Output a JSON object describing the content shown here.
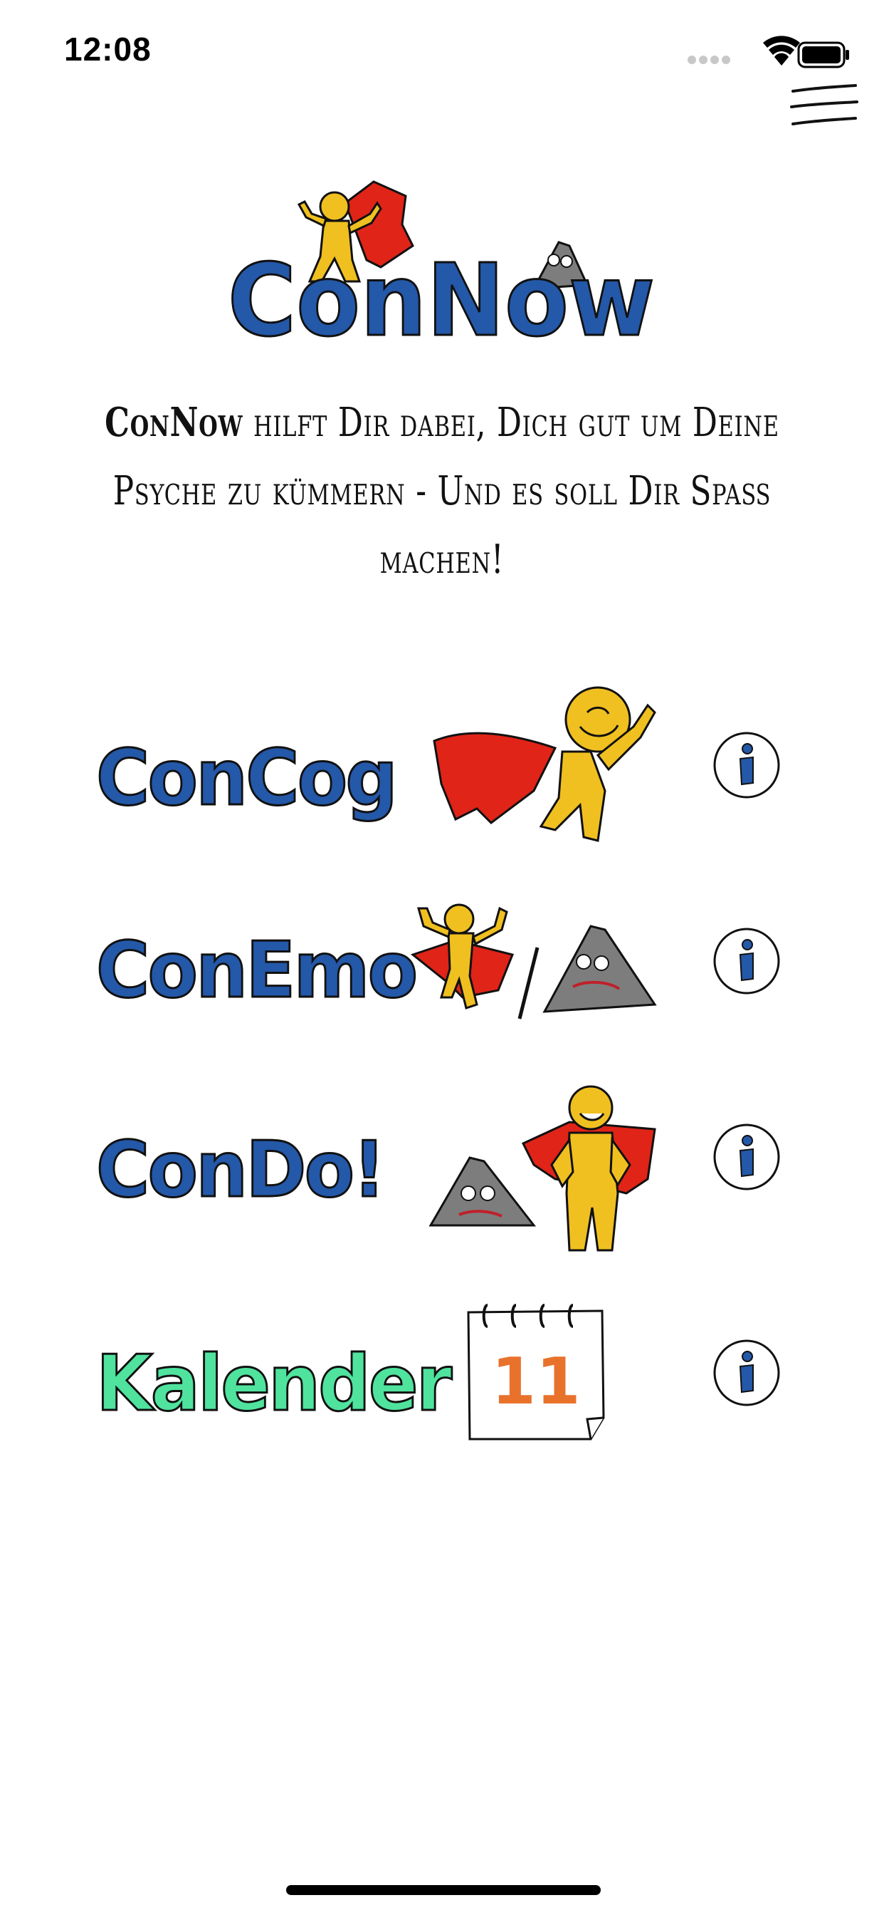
{
  "status_bar": {
    "time": "12:08",
    "icons": [
      "signal-icon",
      "wifi-icon",
      "battery-icon"
    ]
  },
  "header": {
    "menu_icon": "hamburger-menu-icon",
    "logo_text": "ConNow"
  },
  "intro": {
    "brand": "ConNow",
    "text": " hilft Dir dabei, Dich gut um Deine Psyche zu kümmern - Und es soll Dir Spaß machen!"
  },
  "menu": [
    {
      "title": "ConCog",
      "art": "yellow-hero-with-red-cape",
      "info_icon": "info-icon"
    },
    {
      "title": "ConEmo",
      "art": "hero-slash-grey-mountain",
      "info_icon": "info-icon"
    },
    {
      "title": "ConDo!",
      "art": "grey-mountain-and-yellow-hero",
      "info_icon": "info-icon"
    },
    {
      "title": "Kalender",
      "art": "calendar",
      "calendar_day": "11",
      "info_icon": "info-icon"
    }
  ],
  "colors": {
    "title_blue": "#2458a8",
    "title_green": "#4fe39e",
    "hero_yellow": "#f0c020",
    "cape_red": "#e02418",
    "mountain_grey": "#7d7d7d",
    "calendar_orange": "#e8722c"
  }
}
